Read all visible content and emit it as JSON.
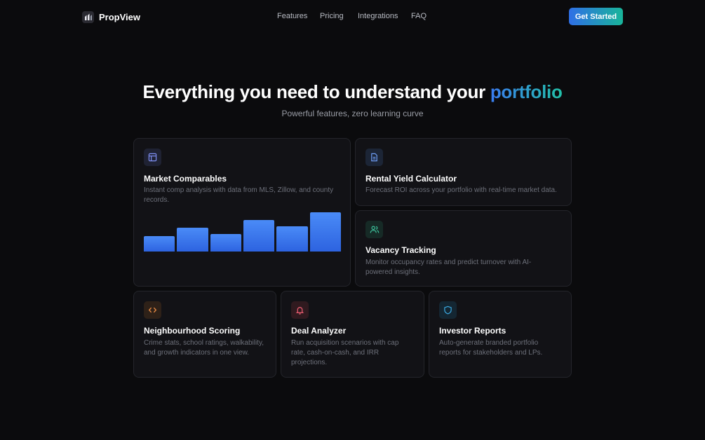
{
  "nav": {
    "brand": "PropView",
    "links": [
      "Features",
      "Pricing",
      "Integrations",
      "FAQ"
    ],
    "cta": "Get Started"
  },
  "hero": {
    "title_main": "Everything you need to understand your ",
    "title_accent": "portfolio",
    "subtitle": "Powerful features, zero learning curve"
  },
  "colors": {
    "accent_blue": "#3a7cf0",
    "accent_teal": "#22c1a8",
    "background": "#0b0b0d",
    "card": "#121216"
  },
  "features": [
    {
      "title": "Market Comparables",
      "description": "Instant comp analysis with data from MLS, Zillow, and county records.",
      "icon": "layout-icon",
      "bars": [
        0.39,
        0.6,
        0.44,
        0.8,
        0.65,
        1.0
      ]
    },
    {
      "title": "Rental Yield Calculator",
      "description": "Forecast ROI across your portfolio with real-time market data.",
      "icon": "document-icon"
    },
    {
      "title": "Vacancy Tracking",
      "description": "Monitor occupancy rates and predict turnover with AI-powered insights.",
      "icon": "users-icon"
    },
    {
      "title": "Neighbourhood Scoring",
      "description": "Crime stats, school ratings, walkability, and growth indicators in one view.",
      "icon": "code-icon"
    },
    {
      "title": "Deal Analyzer",
      "description": "Run acquisition scenarios with cap rate, cash-on-cash, and IRR projections.",
      "icon": "bell-icon"
    },
    {
      "title": "Investor Reports",
      "description": "Auto-generate branded portfolio reports for stakeholders and LPs.",
      "icon": "shield-icon"
    }
  ]
}
